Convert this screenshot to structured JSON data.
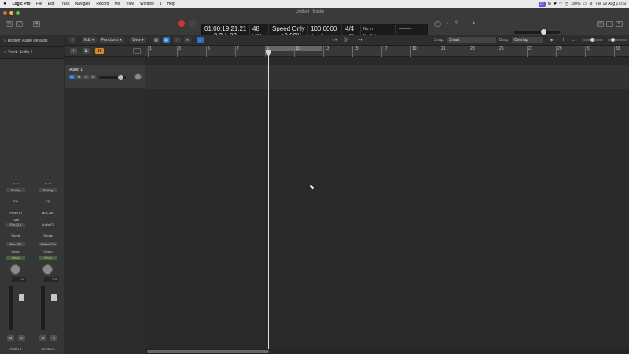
{
  "menubar": {
    "app": "Logic Pro",
    "items": [
      "File",
      "Edit",
      "Track",
      "Navigate",
      "Record",
      "Mix",
      "View",
      "Window",
      "1",
      "Help"
    ],
    "battery": "100%",
    "datetime": "Tue 19 Aug  17:09"
  },
  "window": {
    "title": "Untitled - Tracks"
  },
  "lcd": {
    "time": "01:00:19:21.21",
    "bars": "9  2  1    82",
    "tempo_top": "48",
    "tempo_bottom": "1,024",
    "mode_top": "Speed Only",
    "mode_bottom": "±0.00%",
    "rate_top": "100.0000",
    "rate_bottom": "Keep Tempo",
    "sig_top": "4/4",
    "sig_bottom": "/16",
    "in": "No In",
    "out": "No Out"
  },
  "inspector": {
    "region_label": "Region: Audio Defaults",
    "track_label": "Track: Audio 1",
    "strip1": {
      "setting": "Setting",
      "eq": "EQ",
      "insert1": "Pedro LI",
      "insert2": "Gain",
      "insert3": "Pro-Q 4",
      "sends": "Sends",
      "send1": "Bus 256",
      "group": "Group",
      "automation": "Read",
      "volume": "0.0",
      "m": "M",
      "s": "S",
      "name": "Audio 1"
    },
    "strip2": {
      "setting": "Setting",
      "eq": "EQ",
      "insert1": "Bus 256",
      "insert2": "Audio FX",
      "sends": "Sends",
      "send1": "Stereo Out",
      "group": "Group",
      "automation": "Read",
      "volume": "0.0",
      "m": "M",
      "s": "S",
      "name": "MIXBUS"
    }
  },
  "tracks_toolbar": {
    "edit": "Edit",
    "functions": "Functions",
    "view": "View",
    "snap_label": "Snap:",
    "snap_value": "Smart",
    "drag_label": "Drag:",
    "drag_value": "Overlap"
  },
  "track": {
    "name": "Audio 1",
    "m": "M",
    "s": "S",
    "r": "R"
  },
  "ruler": {
    "bars": [
      "1",
      "3",
      "5",
      "7",
      "9",
      "11",
      "13",
      "15",
      "17",
      "19",
      "21",
      "23",
      "25",
      "27",
      "29",
      "31",
      "33"
    ]
  },
  "colors": {
    "record": "#d0343a",
    "accent_blue": "#2e6fc6",
    "h_button": "#d88a2a",
    "green_read": "#8fd07a"
  }
}
